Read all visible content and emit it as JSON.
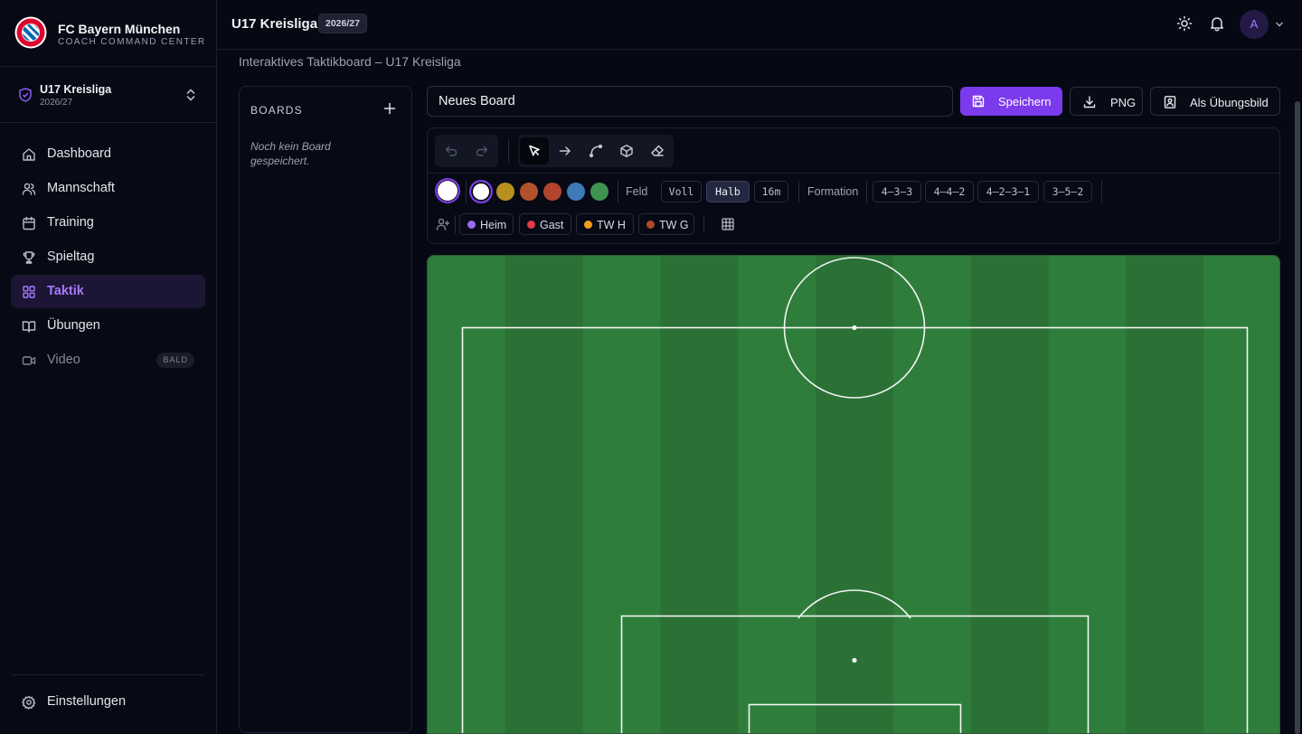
{
  "brand": {
    "name": "FC Bayern München",
    "subtitle": "COACH COMMAND CENTER"
  },
  "team_switcher": {
    "name": "U17 Kreisliga",
    "season": "2026/27"
  },
  "nav": {
    "items": [
      {
        "label": "Dashboard",
        "icon": "home-icon"
      },
      {
        "label": "Mannschaft",
        "icon": "users-icon"
      },
      {
        "label": "Training",
        "icon": "calendar-icon"
      },
      {
        "label": "Spieltag",
        "icon": "trophy-icon"
      },
      {
        "label": "Taktik",
        "icon": "layout-grid-icon",
        "active": true
      },
      {
        "label": "Übungen",
        "icon": "book-open-icon"
      },
      {
        "label": "Video",
        "icon": "video-icon",
        "badge": "BALD",
        "disabled": true
      }
    ],
    "settings_label": "Einstellungen"
  },
  "header": {
    "title": "U17 Kreisliga",
    "season_badge": "2026/27",
    "avatar_initial": "A"
  },
  "page": {
    "subtitle": "Interaktives Taktikboard – U17 Kreisliga"
  },
  "boards": {
    "title": "BOARDS",
    "empty_text": "Noch kein Board gespeichert."
  },
  "editor": {
    "board_name_value": "Neues Board",
    "save_label": "Speichern",
    "png_label": "PNG",
    "exercise_label": "Als Übungsbild"
  },
  "toolbar": {
    "tools": [
      "undo-icon",
      "redo-icon",
      "pointer-icon",
      "arrow-icon",
      "curve-icon",
      "cone-icon",
      "eraser-icon"
    ],
    "active_tool": "pointer-icon",
    "colors": [
      "#ffffff",
      "#ffffff",
      "#b8901e",
      "#b2522c",
      "#b3452e",
      "#3f79b6",
      "#3f9452"
    ],
    "field_label": "Feld",
    "field_options": [
      "Voll",
      "Halb",
      "16m"
    ],
    "field_active": "Halb",
    "formation_label": "Formation",
    "formations": [
      "4–3–3",
      "4–4–2",
      "4–2–3–1",
      "3–5–2"
    ],
    "teams": [
      {
        "label": "Heim",
        "color": "#9b6bf2"
      },
      {
        "label": "Gast",
        "color": "#e23b4a"
      },
      {
        "label": "TW H",
        "color": "#f0a01a"
      },
      {
        "label": "TW G",
        "color": "#b2482a"
      }
    ]
  },
  "pitch": {
    "grass_dark": "#2b7136",
    "grass_light": "#2f7d3b",
    "line_color": "#f2f5f2",
    "view": "half"
  }
}
